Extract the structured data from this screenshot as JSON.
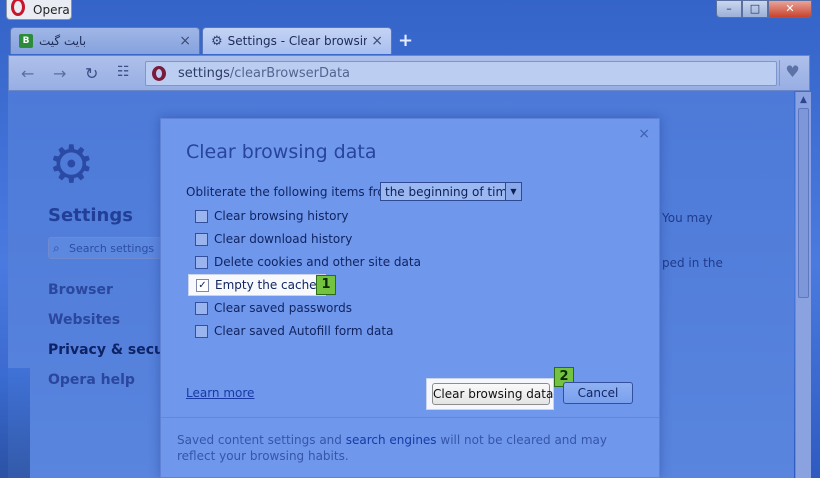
{
  "browser": {
    "menu_label": "Opera",
    "tabs": [
      {
        "title": "بایت گیت",
        "favicon": "B"
      },
      {
        "title": "Settings - Clear browsing d"
      }
    ],
    "url_host": "settings",
    "url_path": "/clearBrowserData"
  },
  "settings_page": {
    "title": "Settings",
    "search_placeholder": "Search settings",
    "nav": [
      "Browser",
      "Websites",
      "Privacy & securit",
      "Opera help"
    ],
    "right_fragments": [
      "You may",
      "ped in the"
    ]
  },
  "dialog": {
    "title": "Clear browsing data",
    "from_label": "Obliterate the following items from:",
    "from_value": "the beginning of time",
    "options": [
      {
        "label": "Clear browsing history",
        "checked": false
      },
      {
        "label": "Clear download history",
        "checked": false
      },
      {
        "label": "Delete cookies and other site data",
        "checked": false
      },
      {
        "label": "Empty the cache",
        "checked": true
      },
      {
        "label": "Clear saved passwords",
        "checked": false
      },
      {
        "label": "Clear saved Autofill form data",
        "checked": false
      }
    ],
    "learn_more": "Learn more",
    "clear_button": "Clear browsing data",
    "cancel_button": "Cancel",
    "footer_pre": "Saved content settings and ",
    "footer_link": "search engines",
    "footer_post": " will not be cleared and may reflect your browsing habits.",
    "markers": [
      "1",
      "2"
    ]
  },
  "colors": {
    "marker_green": "#73c240",
    "tint_blue": "#4a7ae0"
  }
}
